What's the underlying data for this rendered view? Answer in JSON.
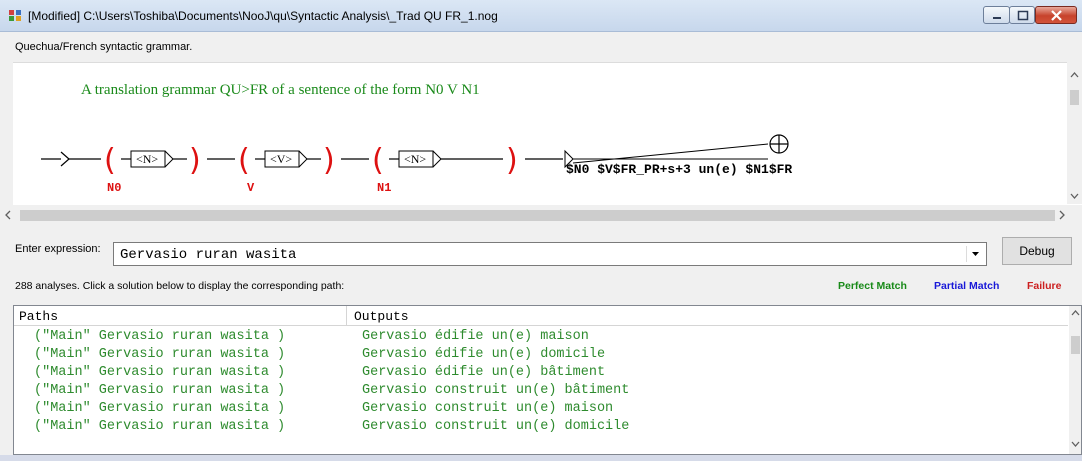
{
  "window": {
    "title": "[Modified] C:\\Users\\Toshiba\\Documents\\NooJ\\qu\\Syntactic Analysis\\_Trad QU FR_1.nog"
  },
  "grammar": {
    "description": "Quechua/French syntactic grammar.",
    "comment": "A translation grammar QU>FR of a sentence of the form N0 V N1",
    "nodes": [
      {
        "box": "<N>",
        "var": "N0"
      },
      {
        "box": "<V>",
        "var": "V"
      },
      {
        "box": "<N>",
        "var": "N1"
      }
    ],
    "output": "$N0 $V$FR_PR+s+3 un(e) $N1$FR"
  },
  "expression": {
    "label": "Enter expression:",
    "value": "Gervasio ruran wasita",
    "debug_label": "Debug"
  },
  "status": {
    "analyses_text": "288 analyses. Click a solution below to display the corresponding path:",
    "perfect_match": "Perfect Match",
    "partial_match": "Partial Match",
    "failure": "Failure"
  },
  "colors": {
    "perfect": "#188a18",
    "partial": "#1818d8",
    "failure": "#cc2020",
    "variable": "#dd1111",
    "comment": "#1a8a1a"
  },
  "results": {
    "headers": [
      "Paths",
      "Outputs"
    ],
    "rows": [
      {
        "path": "(\"Main\" Gervasio ruran wasita )",
        "output": "Gervasio édifie un(e) maison"
      },
      {
        "path": "(\"Main\" Gervasio ruran wasita )",
        "output": "Gervasio édifie un(e) domicile"
      },
      {
        "path": "(\"Main\" Gervasio ruran wasita )",
        "output": "Gervasio édifie un(e) bâtiment"
      },
      {
        "path": "(\"Main\" Gervasio ruran wasita )",
        "output": "Gervasio construit un(e) bâtiment"
      },
      {
        "path": "(\"Main\" Gervasio ruran wasita )",
        "output": "Gervasio construit un(e) maison"
      },
      {
        "path": "(\"Main\" Gervasio ruran wasita )",
        "output": "Gervasio construit un(e) domicile"
      }
    ]
  }
}
